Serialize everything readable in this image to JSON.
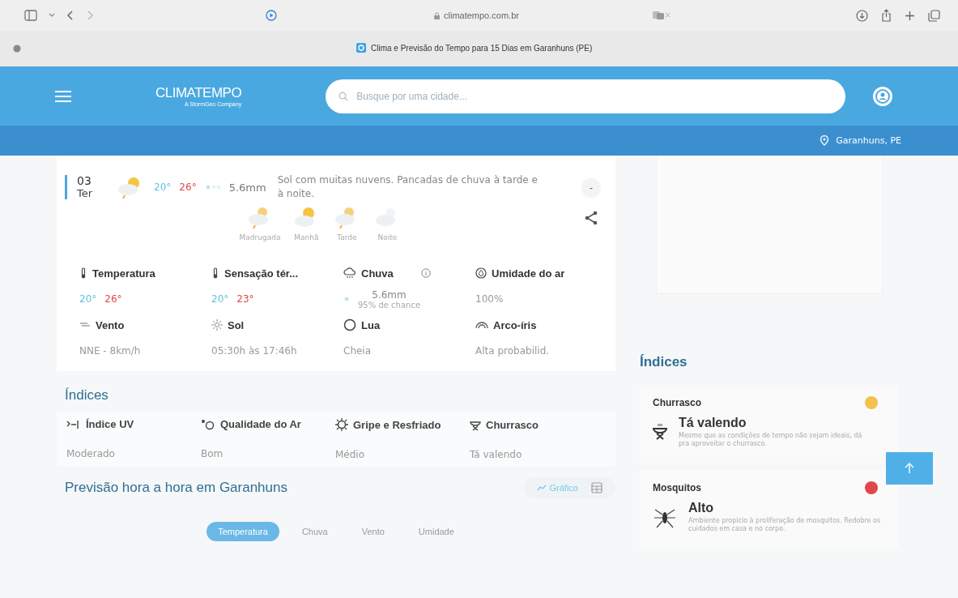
{
  "browser": {
    "address": "climatempo.com.br",
    "tab_title": "Clima e Previsão do Tempo para 15 Dias em Garanhuns (PE)"
  },
  "header": {
    "logo": "CLIMATEMPO",
    "logo_sub": "A StormGeo Company",
    "search": {
      "placeholder": "Busque por uma cidade..."
    },
    "location": "Garanhuns, PE"
  },
  "day": {
    "date": "03",
    "weekday": "Ter",
    "min": "20°",
    "max": "26°",
    "rain": "5.6mm",
    "description": "Sol com muitas nuvens. Pancadas de chuva à tarde e à noite.",
    "collapse": "-",
    "periods": [
      {
        "label": "Madrugada",
        "kind": "rain"
      },
      {
        "label": "Manhã",
        "kind": "sun"
      },
      {
        "label": "Tarde",
        "kind": "rain"
      },
      {
        "label": "Noite",
        "kind": "moon"
      }
    ]
  },
  "details": [
    {
      "label": "Temperatura",
      "kind": "temps",
      "min": "20°",
      "max": "26°"
    },
    {
      "label": "Sensação tér...",
      "kind": "temps",
      "min": "20°",
      "max": "23°"
    },
    {
      "label": "Chuva",
      "kind": "rain",
      "value": "5.6mm",
      "sub": "95% de chance"
    },
    {
      "label": "Umidade do ar",
      "kind": "text",
      "value": "100%"
    },
    {
      "label": "Vento",
      "kind": "text",
      "value": "NNE - 8km/h"
    },
    {
      "label": "Sol",
      "kind": "text",
      "value": "05:30h às 17:46h"
    },
    {
      "label": "Lua",
      "kind": "text",
      "value": "Cheia"
    },
    {
      "label": "Arco-íris",
      "kind": "text",
      "value": "Alta probabilid."
    }
  ],
  "indices": {
    "title": "Índices",
    "items": [
      {
        "name": "Índice UV",
        "value": "Moderado"
      },
      {
        "name": "Qualidade do Ar",
        "value": "Bom"
      },
      {
        "name": "Gripe e Resfriado",
        "value": "Médio"
      },
      {
        "name": "Churrasco",
        "value": "Tá valendo"
      }
    ]
  },
  "hourly": {
    "title": "Previsão hora a hora em Garanhuns",
    "views": [
      {
        "label": "Gráfico",
        "selected": true
      }
    ],
    "tabs": [
      {
        "label": "Temperatura",
        "selected": true
      },
      {
        "label": "Chuva",
        "selected": false
      },
      {
        "label": "Vento",
        "selected": false
      },
      {
        "label": "Umidade",
        "selected": false
      }
    ]
  },
  "side": {
    "title": "Índices",
    "cards": [
      {
        "name": "Churrasco",
        "color": "#f2c14e",
        "level": "Tá valendo",
        "text": "Mesmo que as condições de tempo não sejam ideais, dá pra aproveitar o churrasco."
      },
      {
        "name": "Mosquitos",
        "color": "#e0474c",
        "level": "Alto",
        "text": "Ambiente propício à proliferação de mosquitos. Redobre os cuidados em casa e no corpo."
      }
    ]
  }
}
